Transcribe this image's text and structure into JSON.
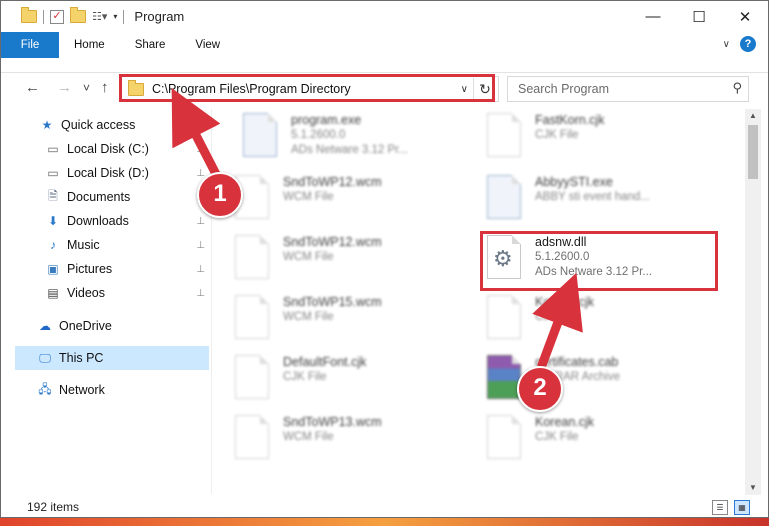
{
  "window": {
    "title": "Program",
    "controls": {
      "minimize": "—",
      "maximize": "☐",
      "close": "✕"
    }
  },
  "ribbon": {
    "tabs": [
      "File",
      "Home",
      "Share",
      "View"
    ],
    "help": "?"
  },
  "address": {
    "path": "C:\\Program Files\\Program Directory",
    "refresh_icon": "↻",
    "dropdown_icon": "∨"
  },
  "search": {
    "placeholder": "Search Program",
    "icon": "⚲"
  },
  "nav_buttons": {
    "back": "←",
    "forward": "→",
    "recent": "˅",
    "up": "↑"
  },
  "sidebar": {
    "items": [
      {
        "label": "Quick access",
        "icon": "star-icon",
        "glyph": "★"
      },
      {
        "label": "Local Disk (C:)",
        "icon": "drive-icon",
        "glyph": "▭",
        "pin": "📌"
      },
      {
        "label": "Local Disk (D:)",
        "icon": "drive-icon",
        "glyph": "▭",
        "pin": "📌"
      },
      {
        "label": "Documents",
        "icon": "documents-icon",
        "glyph": "🗎",
        "pin": "📌"
      },
      {
        "label": "Downloads",
        "icon": "download-icon",
        "glyph": "⬇",
        "pin": "📌"
      },
      {
        "label": "Music",
        "icon": "music-icon",
        "glyph": "♪",
        "pin": "📌"
      },
      {
        "label": "Pictures",
        "icon": "pictures-icon",
        "glyph": "▣",
        "pin": "📌"
      },
      {
        "label": "Videos",
        "icon": "videos-icon",
        "glyph": "▤",
        "pin": "📌"
      },
      {
        "label": "OneDrive",
        "icon": "cloud-icon",
        "glyph": "☁"
      },
      {
        "label": "This PC",
        "icon": "computer-icon",
        "glyph": "🖵"
      },
      {
        "label": "Network",
        "icon": "network-icon",
        "glyph": "🖧"
      }
    ]
  },
  "files": [
    {
      "name": "program.exe",
      "line2": "5.1.2600.0",
      "line3": "ADs Netware 3.12 Pr..."
    },
    {
      "name": "FastKorn.cjk",
      "line2": "CJK File",
      "line3": ""
    },
    {
      "name": "SndToWP12.wcm",
      "line2": "WCM File",
      "line3": ""
    },
    {
      "name": "AbbyySTI.exe",
      "line2": "ABBY sti event hand...",
      "line3": ""
    },
    {
      "name": "SndToWP12.wcm",
      "line2": "WCM File",
      "line3": ""
    },
    {
      "name": "adsnw.dll",
      "line2": "5.1.2600.0",
      "line3": "ADs Netware 3.12 Pr..."
    },
    {
      "name": "SndToWP15.wcm",
      "line2": "WCM File",
      "line3": ""
    },
    {
      "name": "Korean.cjk",
      "line2": "CJK File",
      "line3": ""
    },
    {
      "name": "DefaultFont.cjk",
      "line2": "CJK File",
      "line3": ""
    },
    {
      "name": "certificates.cab",
      "line2": "WinRAR Archive",
      "line3": ""
    },
    {
      "name": "SndToWP13.wcm",
      "line2": "WCM File",
      "line3": ""
    },
    {
      "name": "Korean.cjk",
      "line2": "CJK File",
      "line3": ""
    }
  ],
  "status": {
    "count": "192 items"
  },
  "annotations": {
    "badge1": "1",
    "badge2": "2",
    "color": "#d8323c"
  },
  "colors": {
    "accent": "#1979ca",
    "selected": "#cce8ff",
    "highlight": "#d8323c"
  }
}
